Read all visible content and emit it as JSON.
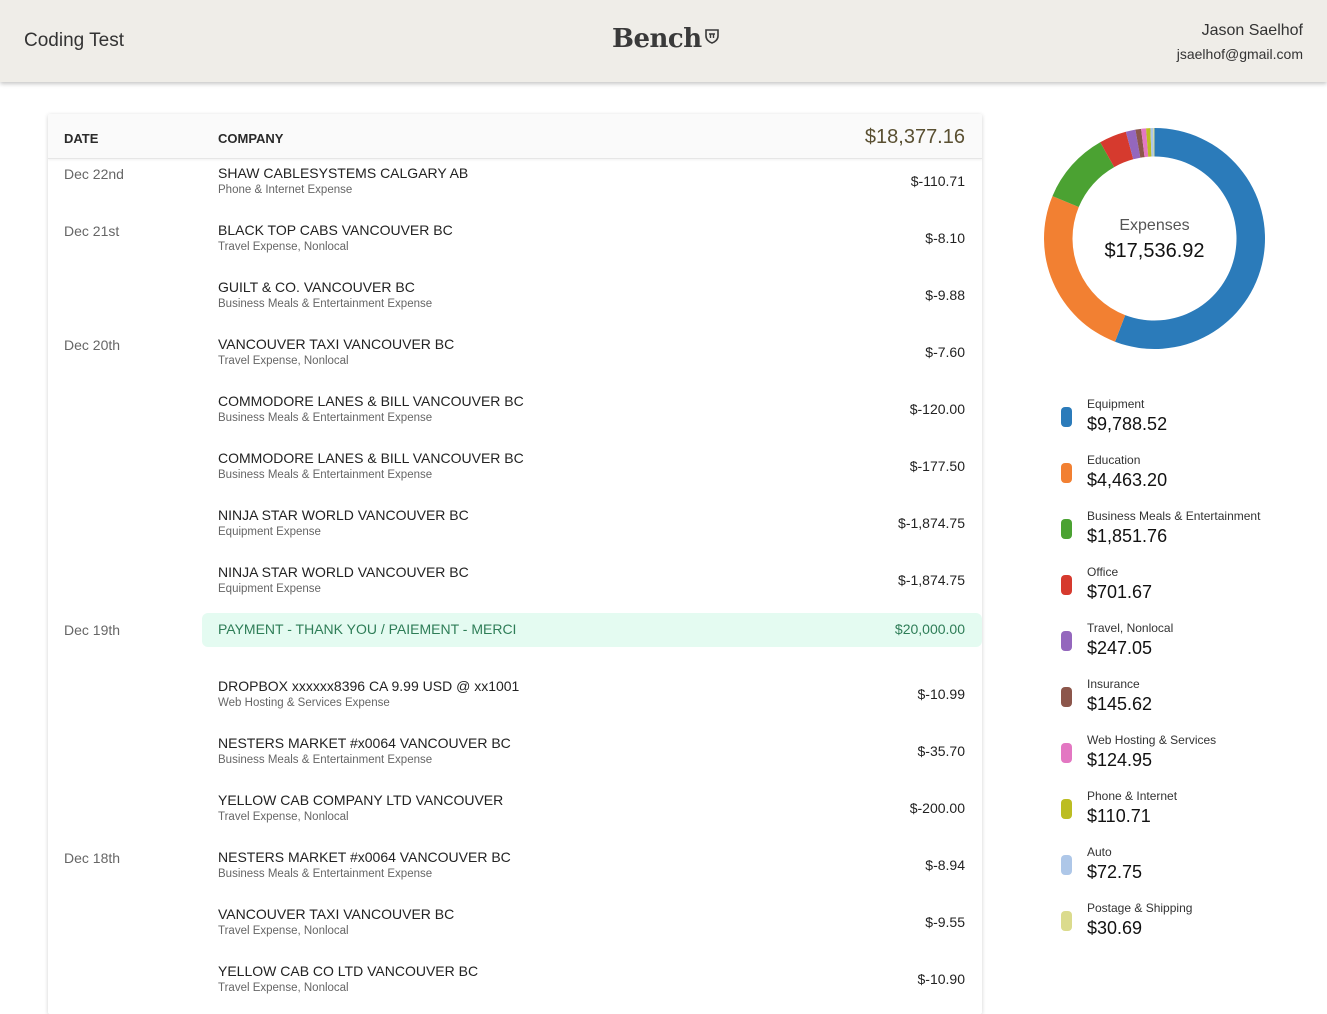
{
  "header": {
    "app_title": "Coding Test",
    "logo_text": "Bench",
    "user_name": "Jason Saelhof",
    "user_email": "jsaelhof@gmail.com"
  },
  "table": {
    "col_date": "DATE",
    "col_company": "COMPANY",
    "total": "$18,377.16",
    "rows": [
      {
        "date": "Dec 22nd",
        "company": "SHAW CABLESYSTEMS CALGARY AB",
        "category": "Phone & Internet Expense",
        "amount": "$-110.71"
      },
      {
        "date": "Dec 21st",
        "company": "BLACK TOP CABS VANCOUVER BC",
        "category": "Travel Expense, Nonlocal",
        "amount": "$-8.10"
      },
      {
        "date": "",
        "company": "GUILT & CO. VANCOUVER BC",
        "category": "Business Meals & Entertainment Expense",
        "amount": "$-9.88"
      },
      {
        "date": "Dec 20th",
        "company": "VANCOUVER TAXI VANCOUVER BC",
        "category": "Travel Expense, Nonlocal",
        "amount": "$-7.60"
      },
      {
        "date": "",
        "company": "COMMODORE LANES & BILL VANCOUVER BC",
        "category": "Business Meals & Entertainment Expense",
        "amount": "$-120.00"
      },
      {
        "date": "",
        "company": "COMMODORE LANES & BILL VANCOUVER BC",
        "category": "Business Meals & Entertainment Expense",
        "amount": "$-177.50"
      },
      {
        "date": "",
        "company": "NINJA STAR WORLD VANCOUVER BC",
        "category": "Equipment Expense",
        "amount": "$-1,874.75"
      },
      {
        "date": "",
        "company": "NINJA STAR WORLD VANCOUVER BC",
        "category": "Equipment Expense",
        "amount": "$-1,874.75"
      },
      {
        "date": "Dec 19th",
        "company": "PAYMENT - THANK YOU / PAIEMENT - MERCI",
        "category": "",
        "amount": "$20,000.00",
        "payment": true
      },
      {
        "date": "",
        "company": "DROPBOX xxxxxx8396 CA 9.99 USD @ xx1001",
        "category": "Web Hosting & Services Expense",
        "amount": "$-10.99"
      },
      {
        "date": "",
        "company": "NESTERS MARKET #x0064 VANCOUVER BC",
        "category": "Business Meals & Entertainment Expense",
        "amount": "$-35.70"
      },
      {
        "date": "",
        "company": "YELLOW CAB COMPANY LTD VANCOUVER",
        "category": "Travel Expense, Nonlocal",
        "amount": "$-200.00"
      },
      {
        "date": "Dec 18th",
        "company": "NESTERS MARKET #x0064 VANCOUVER BC",
        "category": "Business Meals & Entertainment Expense",
        "amount": "$-8.94"
      },
      {
        "date": "",
        "company": "VANCOUVER TAXI VANCOUVER BC",
        "category": "Travel Expense, Nonlocal",
        "amount": "$-9.55"
      },
      {
        "date": "",
        "company": "YELLOW CAB CO LTD VANCOUVER BC",
        "category": "Travel Expense, Nonlocal",
        "amount": "$-10.90"
      }
    ]
  },
  "expenses": {
    "label": "Expenses",
    "total": "$17,536.92"
  },
  "chart_data": {
    "type": "pie",
    "title": "Expenses",
    "categories": [
      "Equipment",
      "Education",
      "Business Meals & Entertainment",
      "Office",
      "Travel, Nonlocal",
      "Insurance",
      "Web Hosting & Services",
      "Phone & Internet",
      "Auto",
      "Postage & Shipping"
    ],
    "values": [
      9788.52,
      4463.2,
      1851.76,
      701.67,
      247.05,
      145.62,
      124.95,
      110.71,
      72.75,
      30.69
    ],
    "display_values": [
      "$9,788.52",
      "$4,463.20",
      "$1,851.76",
      "$701.67",
      "$247.05",
      "$145.62",
      "$124.95",
      "$110.71",
      "$72.75",
      "$30.69"
    ],
    "colors": [
      "#2b7bba",
      "#f28032",
      "#4ba232",
      "#d63a2e",
      "#9467bd",
      "#8c564b",
      "#e377c2",
      "#bcbd22",
      "#aec7e8",
      "#dbdb8d"
    ]
  }
}
